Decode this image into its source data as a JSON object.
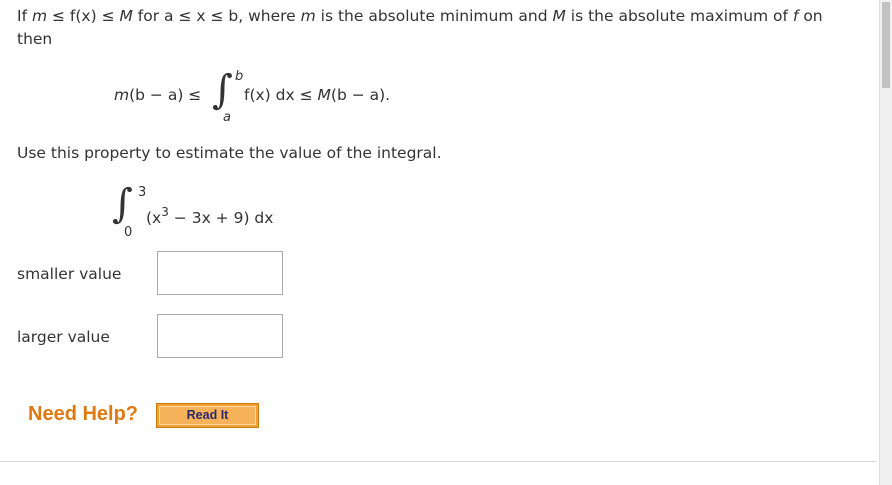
{
  "intro": {
    "w1": "If ",
    "m1": "m",
    "w2": " ≤ f(x) ≤ ",
    "M1": "M",
    "w3": " for a ≤ x ≤ b, where ",
    "m2": "m",
    "w4": " is the absolute minimum and ",
    "M2": "M",
    "w5": " is the absolute maximum of ",
    "f": "f",
    "w6": " on",
    "line2": "then"
  },
  "property": {
    "left_m": "m",
    "left_rest": "(b − a) ≤",
    "integral_sign": "∫",
    "upper": "b",
    "lower": "a",
    "integrand": "f(x) dx ≤ ",
    "right_M": "M",
    "right_rest": "(b − a)."
  },
  "instruction": "Use this property to estimate the value of the integral.",
  "integral": {
    "integral_sign": "∫",
    "upper": "3",
    "lower": "0",
    "open": "(x",
    "exp": "3",
    "rest": " − 3x + 9) dx"
  },
  "fields": {
    "smaller_label": "smaller value",
    "smaller_value": "",
    "larger_label": "larger value",
    "larger_value": ""
  },
  "help": {
    "need_help": "Need Help?",
    "read_it": "Read It"
  },
  "colors": {
    "need_help": "#e07a10",
    "read_button": "#f0a030"
  }
}
